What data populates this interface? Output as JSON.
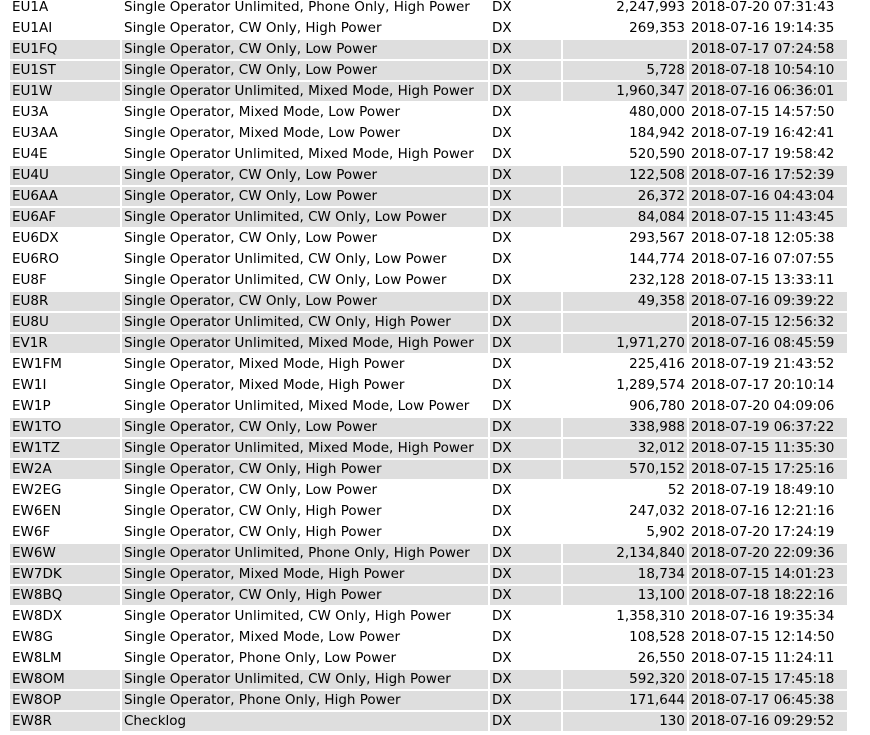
{
  "rows": [
    {
      "call": "EU1A",
      "category": "Single Operator Unlimited, Phone Only, High Power",
      "location": "DX",
      "score": "2,247,993",
      "time": "2018-07-20 07:31:43",
      "shaded": false
    },
    {
      "call": "EU1AI",
      "category": "Single Operator, CW Only, High Power",
      "location": "DX",
      "score": "269,353",
      "time": "2018-07-16 19:14:35",
      "shaded": false
    },
    {
      "call": "EU1FQ",
      "category": "Single Operator, CW Only, Low Power",
      "location": "DX",
      "score": "",
      "time": "2018-07-17 07:24:58",
      "shaded": true
    },
    {
      "call": "EU1ST",
      "category": "Single Operator, CW Only, Low Power",
      "location": "DX",
      "score": "5,728",
      "time": "2018-07-18 10:54:10",
      "shaded": true
    },
    {
      "call": "EU1W",
      "category": "Single Operator Unlimited, Mixed Mode, High Power",
      "location": "DX",
      "score": "1,960,347",
      "time": "2018-07-16 06:36:01",
      "shaded": true
    },
    {
      "call": "EU3A",
      "category": "Single Operator, Mixed Mode, Low Power",
      "location": "DX",
      "score": "480,000",
      "time": "2018-07-15 14:57:50",
      "shaded": false
    },
    {
      "call": "EU3AA",
      "category": "Single Operator, Mixed Mode, Low Power",
      "location": "DX",
      "score": "184,942",
      "time": "2018-07-19 16:42:41",
      "shaded": false
    },
    {
      "call": "EU4E",
      "category": "Single Operator Unlimited, Mixed Mode, High Power",
      "location": "DX",
      "score": "520,590",
      "time": "2018-07-17 19:58:42",
      "shaded": false
    },
    {
      "call": "EU4U",
      "category": "Single Operator, CW Only, Low Power",
      "location": "DX",
      "score": "122,508",
      "time": "2018-07-16 17:52:39",
      "shaded": true
    },
    {
      "call": "EU6AA",
      "category": "Single Operator, CW Only, Low Power",
      "location": "DX",
      "score": "26,372",
      "time": "2018-07-16 04:43:04",
      "shaded": true
    },
    {
      "call": "EU6AF",
      "category": "Single Operator Unlimited, CW Only, Low Power",
      "location": "DX",
      "score": "84,084",
      "time": "2018-07-15 11:43:45",
      "shaded": true
    },
    {
      "call": "EU6DX",
      "category": "Single Operator, CW Only, Low Power",
      "location": "DX",
      "score": "293,567",
      "time": "2018-07-18 12:05:38",
      "shaded": false
    },
    {
      "call": "EU6RO",
      "category": "Single Operator Unlimited, CW Only, Low Power",
      "location": "DX",
      "score": "144,774",
      "time": "2018-07-16 07:07:55",
      "shaded": false
    },
    {
      "call": "EU8F",
      "category": "Single Operator Unlimited, CW Only, Low Power",
      "location": "DX",
      "score": "232,128",
      "time": "2018-07-15 13:33:11",
      "shaded": false
    },
    {
      "call": "EU8R",
      "category": "Single Operator, CW Only, Low Power",
      "location": "DX",
      "score": "49,358",
      "time": "2018-07-16 09:39:22",
      "shaded": true
    },
    {
      "call": "EU8U",
      "category": "Single Operator Unlimited, CW Only, High Power",
      "location": "DX",
      "score": "",
      "time": "2018-07-15 12:56:32",
      "shaded": true
    },
    {
      "call": "EV1R",
      "category": "Single Operator Unlimited, Mixed Mode, High Power",
      "location": "DX",
      "score": "1,971,270",
      "time": "2018-07-16 08:45:59",
      "shaded": true
    },
    {
      "call": "EW1FM",
      "category": "Single Operator, Mixed Mode, High Power",
      "location": "DX",
      "score": "225,416",
      "time": "2018-07-19 21:43:52",
      "shaded": false
    },
    {
      "call": "EW1I",
      "category": "Single Operator, Mixed Mode, High Power",
      "location": "DX",
      "score": "1,289,574",
      "time": "2018-07-17 20:10:14",
      "shaded": false
    },
    {
      "call": "EW1P",
      "category": "Single Operator Unlimited, Mixed Mode, Low Power",
      "location": "DX",
      "score": "906,780",
      "time": "2018-07-20 04:09:06",
      "shaded": false
    },
    {
      "call": "EW1TO",
      "category": "Single Operator, CW Only, Low Power",
      "location": "DX",
      "score": "338,988",
      "time": "2018-07-19 06:37:22",
      "shaded": true
    },
    {
      "call": "EW1TZ",
      "category": "Single Operator Unlimited, Mixed Mode, High Power",
      "location": "DX",
      "score": "32,012",
      "time": "2018-07-15 11:35:30",
      "shaded": true
    },
    {
      "call": "EW2A",
      "category": "Single Operator, CW Only, High Power",
      "location": "DX",
      "score": "570,152",
      "time": "2018-07-15 17:25:16",
      "shaded": true
    },
    {
      "call": "EW2EG",
      "category": "Single Operator, CW Only, Low Power",
      "location": "DX",
      "score": "52",
      "time": "2018-07-19 18:49:10",
      "shaded": false
    },
    {
      "call": "EW6EN",
      "category": "Single Operator, CW Only, High Power",
      "location": "DX",
      "score": "247,032",
      "time": "2018-07-16 12:21:16",
      "shaded": false
    },
    {
      "call": "EW6F",
      "category": "Single Operator, CW Only, High Power",
      "location": "DX",
      "score": "5,902",
      "time": "2018-07-20 17:24:19",
      "shaded": false
    },
    {
      "call": "EW6W",
      "category": "Single Operator Unlimited, Phone Only, High Power",
      "location": "DX",
      "score": "2,134,840",
      "time": "2018-07-20 22:09:36",
      "shaded": true
    },
    {
      "call": "EW7DK",
      "category": "Single Operator, Mixed Mode, High Power",
      "location": "DX",
      "score": "18,734",
      "time": "2018-07-15 14:01:23",
      "shaded": true
    },
    {
      "call": "EW8BQ",
      "category": "Single Operator, CW Only, High Power",
      "location": "DX",
      "score": "13,100",
      "time": "2018-07-18 18:22:16",
      "shaded": true
    },
    {
      "call": "EW8DX",
      "category": "Single Operator Unlimited, CW Only, High Power",
      "location": "DX",
      "score": "1,358,310",
      "time": "2018-07-16 19:35:34",
      "shaded": false
    },
    {
      "call": "EW8G",
      "category": "Single Operator, Mixed Mode, Low Power",
      "location": "DX",
      "score": "108,528",
      "time": "2018-07-15 12:14:50",
      "shaded": false
    },
    {
      "call": "EW8LM",
      "category": "Single Operator, Phone Only, Low Power",
      "location": "DX",
      "score": "26,550",
      "time": "2018-07-15 11:24:11",
      "shaded": false
    },
    {
      "call": "EW8OM",
      "category": "Single Operator Unlimited, CW Only, High Power",
      "location": "DX",
      "score": "592,320",
      "time": "2018-07-15 17:45:18",
      "shaded": true
    },
    {
      "call": "EW8OP",
      "category": "Single Operator, Phone Only, High Power",
      "location": "DX",
      "score": "171,644",
      "time": "2018-07-17 06:45:38",
      "shaded": true
    },
    {
      "call": "EW8R",
      "category": "Checklog",
      "location": "DX",
      "score": "130",
      "time": "2018-07-16 09:29:52",
      "shaded": true
    }
  ]
}
